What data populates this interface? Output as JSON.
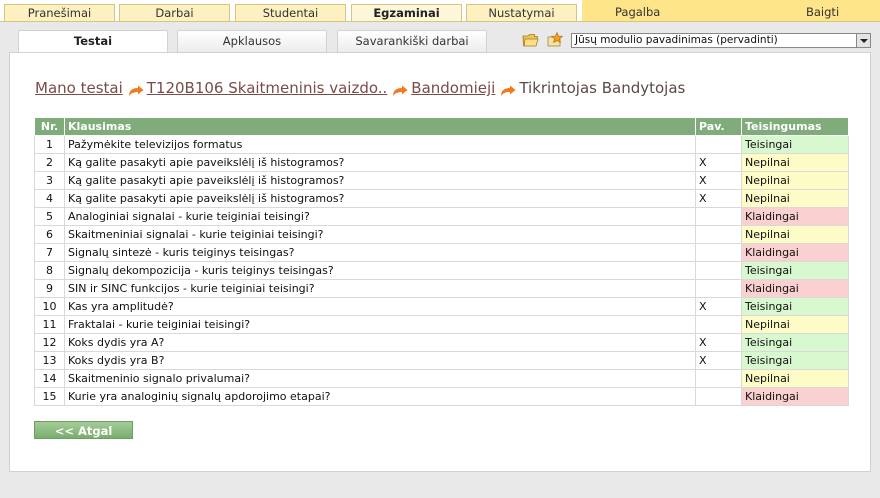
{
  "top_menu": {
    "tabs": [
      {
        "label": "Pranešimai"
      },
      {
        "label": "Darbai"
      },
      {
        "label": "Studentai"
      },
      {
        "label": "Egzaminai"
      },
      {
        "label": "Nustatymai"
      }
    ],
    "help": "Pagalba",
    "exit": "Baigti"
  },
  "sub_tabs": [
    {
      "label": "Testai"
    },
    {
      "label": "Apklausos"
    },
    {
      "label": "Savarankiški darbai"
    }
  ],
  "module_select": {
    "value": "Jūsų modulio pavadinimas (pervadinti)"
  },
  "breadcrumb": {
    "items": [
      "Mano testai",
      "T120B106 Skaitmeninis vaizdo..",
      "Bandomieji"
    ],
    "current": "Tikrintojas Bandytojas"
  },
  "table": {
    "headers": [
      "Nr.",
      "Klausimas",
      "Pav.",
      "Teisingumas"
    ],
    "rows": [
      {
        "nr": "1",
        "question": "Pažymėkite televizijos formatus",
        "pav": "",
        "status": "Teisingai",
        "kind": "ok"
      },
      {
        "nr": "2",
        "question": "Ką galite pasakyti apie paveikslėlį iš histogramos?",
        "pav": "X",
        "status": "Nepilnai",
        "kind": "part"
      },
      {
        "nr": "3",
        "question": "Ką galite pasakyti apie paveikslėlį iš histogramos?",
        "pav": "X",
        "status": "Nepilnai",
        "kind": "part"
      },
      {
        "nr": "4",
        "question": "Ką galite pasakyti apie paveikslėlį iš histogramos?",
        "pav": "X",
        "status": "Nepilnai",
        "kind": "part"
      },
      {
        "nr": "5",
        "question": "Analoginiai signalai - kurie teiginiai teisingi?",
        "pav": "",
        "status": "Klaidingai",
        "kind": "bad"
      },
      {
        "nr": "6",
        "question": "Skaitmeniniai signalai - kurie teiginiai teisingi?",
        "pav": "",
        "status": "Nepilnai",
        "kind": "part"
      },
      {
        "nr": "7",
        "question": "Signalų sintezė - kuris teiginys teisingas?",
        "pav": "",
        "status": "Klaidingai",
        "kind": "bad"
      },
      {
        "nr": "8",
        "question": "Signalų dekompozicija - kuris teiginys teisingas?",
        "pav": "",
        "status": "Teisingai",
        "kind": "ok"
      },
      {
        "nr": "9",
        "question": "SIN ir SINC funkcijos - kurie teiginiai teisingi?",
        "pav": "",
        "status": "Klaidingai",
        "kind": "bad"
      },
      {
        "nr": "10",
        "question": "Kas yra amplitudė?",
        "pav": "X",
        "status": "Teisingai",
        "kind": "ok"
      },
      {
        "nr": "11",
        "question": "Fraktalai - kurie teiginiai teisingi?",
        "pav": "",
        "status": "Nepilnai",
        "kind": "part"
      },
      {
        "nr": "12",
        "question": "Koks dydis yra A?",
        "pav": "X",
        "status": "Teisingai",
        "kind": "ok"
      },
      {
        "nr": "13",
        "question": "Koks dydis yra B?",
        "pav": "X",
        "status": "Teisingai",
        "kind": "ok"
      },
      {
        "nr": "14",
        "question": "Skaitmeninio signalo privalumai?",
        "pav": "",
        "status": "Nepilnai",
        "kind": "part"
      },
      {
        "nr": "15",
        "question": "Kurie yra analoginių signalų apdorojimo etapai?",
        "pav": "",
        "status": "Klaidingai",
        "kind": "bad"
      }
    ]
  },
  "back_button": "<< Atgal",
  "colors": {
    "header_green": "#7fac7a",
    "status_ok": "#d8f8d0",
    "status_partial": "#fdfcc6",
    "status_wrong": "#fbd0d0",
    "link_brown": "#7a4c48",
    "menu_gold": "#ffe58a"
  },
  "icons": [
    "folder-open-icon",
    "star-icon",
    "orange-arrow-icon",
    "dropdown-arrow-icon"
  ]
}
